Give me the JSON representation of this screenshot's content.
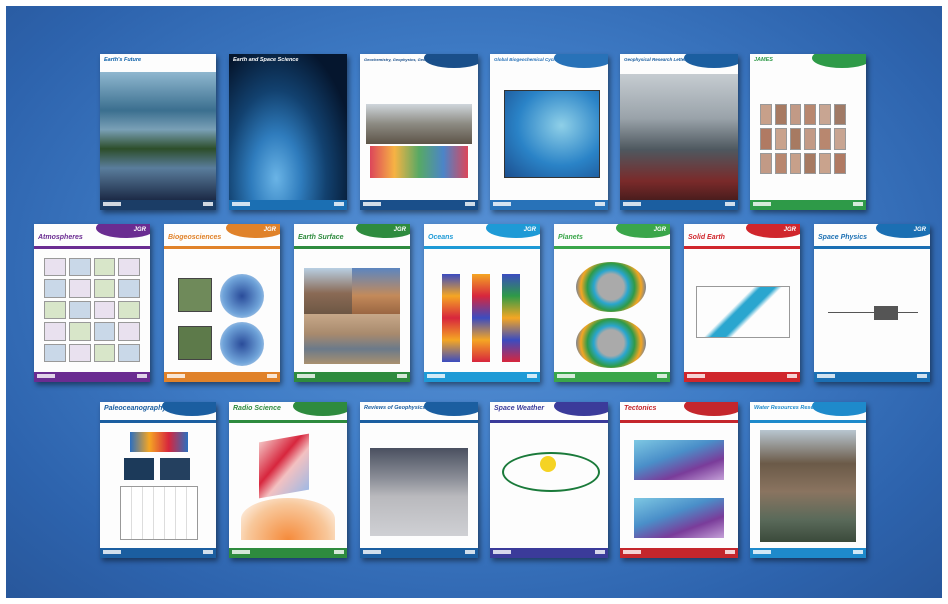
{
  "rows": [
    {
      "covers": [
        {
          "title": "Earth's Future",
          "tag": "",
          "accent": "#0a5fa8",
          "foot": "#0a5fa8"
        },
        {
          "title": "Earth and Space Science",
          "tag": "",
          "accent": "#1b6fb3",
          "foot": "#1b6fb3"
        },
        {
          "title": "Geochemistry, Geophysics, Geosystems",
          "tag": "",
          "accent": "#1a4f8a",
          "foot": "#1a4f8a"
        },
        {
          "title": "Global Biogeochemical Cycles",
          "tag": "",
          "accent": "#2872b8",
          "foot": "#2872b8"
        },
        {
          "title": "Geophysical Research Letters",
          "tag": "",
          "accent": "#1b5ea0",
          "foot": "#1b5ea0"
        },
        {
          "title": "JAMES",
          "tag": "",
          "accent": "#2e9a48",
          "foot": "#2e9a48"
        }
      ]
    },
    {
      "covers": [
        {
          "title": "Atmospheres",
          "tag": "JGR",
          "accent": "#6a2c91",
          "foot": "#6a2c91"
        },
        {
          "title": "Biogeosciences",
          "tag": "JGR",
          "accent": "#e0822a",
          "foot": "#e0822a"
        },
        {
          "title": "Earth Surface",
          "tag": "JGR",
          "accent": "#2e8b3e",
          "foot": "#2e8b3e"
        },
        {
          "title": "Oceans",
          "tag": "JGR",
          "accent": "#1e9ad6",
          "foot": "#1e9ad6"
        },
        {
          "title": "Planets",
          "tag": "JGR",
          "accent": "#3aa64a",
          "foot": "#3aa64a"
        },
        {
          "title": "Solid Earth",
          "tag": "JGR",
          "accent": "#d0262c",
          "foot": "#d0262c"
        },
        {
          "title": "Space Physics",
          "tag": "JGR",
          "accent": "#1b6fb3",
          "foot": "#1b6fb3"
        }
      ]
    },
    {
      "covers": [
        {
          "title": "Paleoceanography",
          "tag": "",
          "accent": "#1b5ea0",
          "foot": "#1b5ea0"
        },
        {
          "title": "Radio Science",
          "tag": "",
          "accent": "#2e8b3e",
          "foot": "#2e8b3e"
        },
        {
          "title": "Reviews of Geophysics",
          "tag": "",
          "accent": "#1b5ea0",
          "foot": "#1b5ea0"
        },
        {
          "title": "Space Weather",
          "tag": "",
          "accent": "#3b3b9a",
          "foot": "#3b3b9a"
        },
        {
          "title": "Tectonics",
          "tag": "",
          "accent": "#c4262c",
          "foot": "#c4262c"
        },
        {
          "title": "Water Resources Research",
          "tag": "",
          "accent": "#1e8acb",
          "foot": "#1e8acb"
        }
      ]
    }
  ]
}
